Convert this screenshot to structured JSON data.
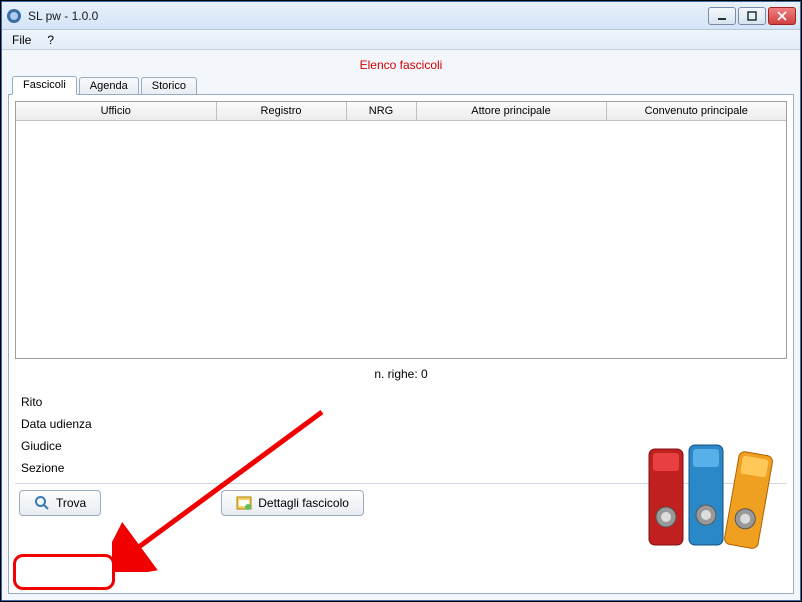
{
  "window": {
    "title": "SL pw - 1.0.0"
  },
  "menu": {
    "file": "File",
    "help": "?"
  },
  "heading": "Elenco fascicoli",
  "tabs": {
    "fascicoli": "Fascicoli",
    "agenda": "Agenda",
    "storico": "Storico"
  },
  "columns": {
    "ufficio": "Ufficio",
    "registro": "Registro",
    "nrg": "NRG",
    "attore": "Attore principale",
    "convenuto": "Convenuto principale"
  },
  "rows": [],
  "row_count_label": "n. righe: 0",
  "filters": {
    "rito": "Rito",
    "data_udienza": "Data udienza",
    "giudice": "Giudice",
    "sezione": "Sezione"
  },
  "buttons": {
    "trova": "Trova",
    "dettagli": "Dettagli fascicolo"
  }
}
